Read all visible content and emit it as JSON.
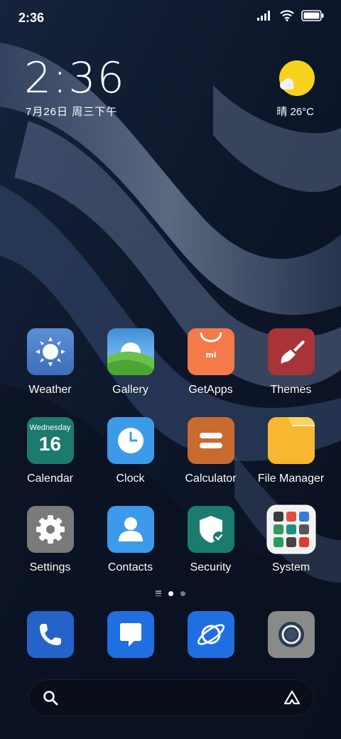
{
  "status_bar": {
    "time": "2:36"
  },
  "lock_widget": {
    "clock": "2:36",
    "date": "7月26日 周三下午",
    "weather": "晴 26°C"
  },
  "calendar_icon": {
    "weekday": "Wednesday",
    "day": "16"
  },
  "apps": [
    {
      "label": "Weather"
    },
    {
      "label": "Gallery"
    },
    {
      "label": "GetApps"
    },
    {
      "label": "Themes"
    },
    {
      "label": "Calendar"
    },
    {
      "label": "Clock"
    },
    {
      "label": "Calculator"
    },
    {
      "label": "File Manager"
    },
    {
      "label": "Settings"
    },
    {
      "label": "Contacts"
    },
    {
      "label": "Security"
    },
    {
      "label": "System"
    }
  ],
  "page_indicator": {
    "current_page": 1,
    "total_pages": 2
  },
  "dock": [
    {
      "icon": "phone-icon"
    },
    {
      "icon": "messages-icon"
    },
    {
      "icon": "browser-icon"
    },
    {
      "icon": "camera-icon"
    }
  ],
  "search_bar": {
    "left_icon": "search-icon",
    "right_icon": "assistant-icon"
  }
}
